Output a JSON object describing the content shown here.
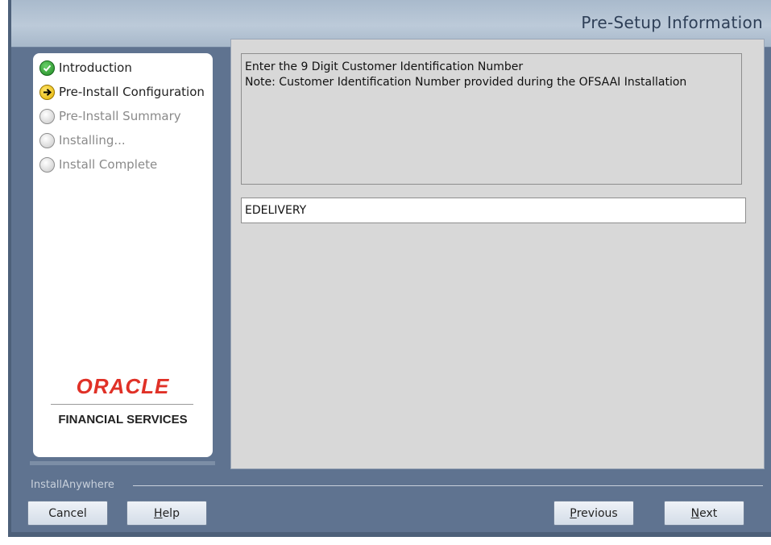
{
  "window": {
    "title": "Pre-Setup Information"
  },
  "steps": [
    {
      "label": "Introduction",
      "state": "done"
    },
    {
      "label": "Pre-Install Configuration",
      "state": "current"
    },
    {
      "label": "Pre-Install Summary",
      "state": "pending"
    },
    {
      "label": "Installing...",
      "state": "pending"
    },
    {
      "label": "Install Complete",
      "state": "pending"
    }
  ],
  "branding": {
    "logo": "ORACLE",
    "subtitle": "FINANCIAL SERVICES"
  },
  "message": {
    "line1": "Enter the 9 Digit Customer Identification Number",
    "line2": "Note: Customer Identification Number provided during the OFSAAI Installation"
  },
  "cin_field": {
    "value": "EDELIVERY"
  },
  "footer": {
    "label": "InstallAnywhere"
  },
  "buttons": {
    "cancel": "Cancel",
    "help_prefix": "",
    "help_mnemonic": "H",
    "help_rest": "elp",
    "previous_mnemonic": "P",
    "previous_rest": "revious",
    "next_mnemonic": "N",
    "next_rest": "ext"
  },
  "colors": {
    "titlebar": "#bccad9",
    "frame": "#5f7390",
    "panel": "#d8d8d8",
    "oracle_red": "#e03127"
  },
  "icons": {
    "done": "check-circle-icon",
    "current": "arrow-right-circle-icon",
    "pending": "empty-circle-icon"
  }
}
